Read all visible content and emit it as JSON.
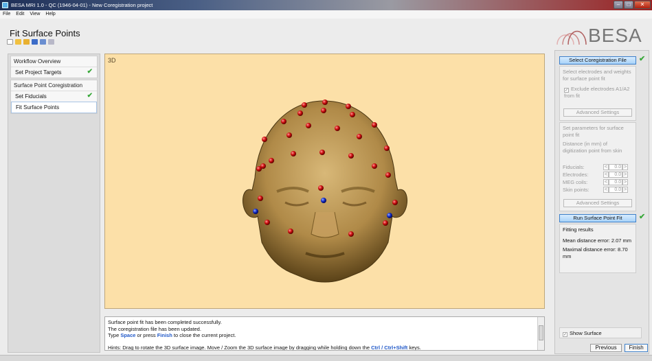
{
  "window": {
    "title": "BESA MRI 1.0 - QC (1946-04-01) - New Coregistration project"
  },
  "menu": {
    "file": "File",
    "edit": "Edit",
    "view": "View",
    "help": "Help"
  },
  "page": {
    "title": "Fit Surface Points"
  },
  "logo": {
    "text": "BESA"
  },
  "workflow": {
    "group1": {
      "header": "Workflow Overview",
      "items": [
        "Set Project Targets"
      ]
    },
    "group2": {
      "header": "Surface Point Coregistration",
      "items": [
        "Set Fiducials",
        "Fit Surface Points"
      ]
    }
  },
  "viewport": {
    "label": "3D"
  },
  "messages": {
    "line1": "Surface point fit has been completed successfully.",
    "line2": "The coregistration file has been updated.",
    "line3_pre": "Type ",
    "line3_space": "Space",
    "line3_mid": " or press ",
    "line3_finish": "Finish",
    "line3_post": " to close the current project.",
    "line4_pre": "Hints: Drag to rotate the 3D surface image. Move / Zoom the 3D surface image by dragging while holding down the ",
    "line4_keys": "Ctrl / Ctrl+Shift",
    "line4_post": " keys."
  },
  "right": {
    "select_button": "Select Coregistration File",
    "select_desc": "Select electrodes and weights for surface point fit",
    "exclude_label": "Exclude electrodes A1/A2 from fit",
    "advanced_1": "Advanced Settings",
    "params_desc": "Set parameters for surface point fit",
    "distance_desc": "Distance (in mm) of digitization point from skin",
    "params": [
      {
        "label": "Fiducials:",
        "value": "0.0"
      },
      {
        "label": "Electrodes:",
        "value": "0.0"
      },
      {
        "label": "MEG coils:",
        "value": "0.0"
      },
      {
        "label": "Skin points:",
        "value": "0.0"
      }
    ],
    "advanced_2": "Advanced Settings",
    "run_button": "Run Surface Point Fit",
    "results_title": "Fitting results",
    "mean_error": "Mean distance error: 2.07 mm",
    "max_error": "Maximal distance error: 8.70 mm",
    "show_surface": "Show Surface",
    "previous": "Previous",
    "finish": "Finish"
  },
  "colors": {
    "accent": "#3d7fc9",
    "check": "#39a83a",
    "viewport_bg": "#fce0a8"
  }
}
